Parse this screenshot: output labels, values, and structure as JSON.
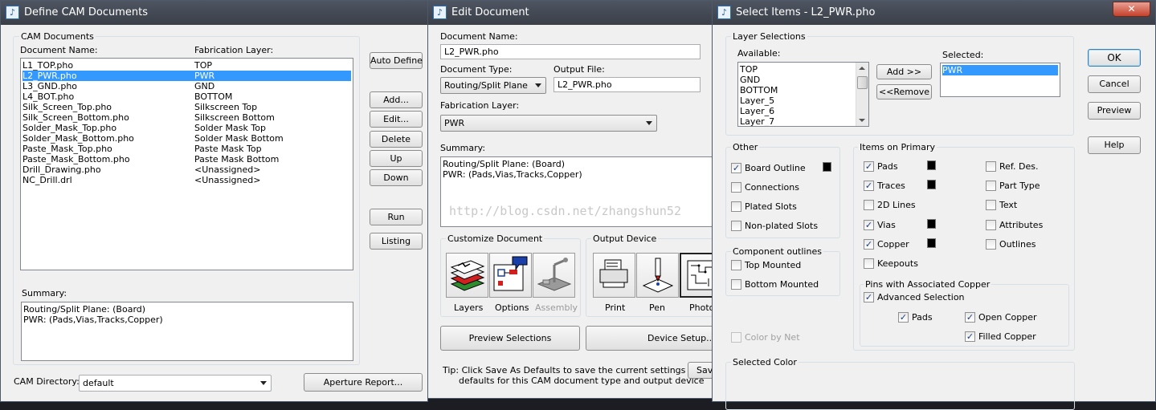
{
  "define_window": {
    "title": "Define CAM Documents",
    "group_label": "CAM Documents",
    "col_document_name": "Document Name:",
    "col_fabrication_layer": "Fabrication Layer:",
    "documents": [
      {
        "name": "L1_TOP.pho",
        "layer": "TOP"
      },
      {
        "name": "L2_PWR.pho",
        "layer": "PWR"
      },
      {
        "name": "L3_GND.pho",
        "layer": "GND"
      },
      {
        "name": "L4_BOT.pho",
        "layer": "BOTTOM"
      },
      {
        "name": "Silk_Screen_Top.pho",
        "layer": "Silkscreen Top"
      },
      {
        "name": "Silk_Screen_Bottom.pho",
        "layer": "Silkscreen Bottom"
      },
      {
        "name": "Solder_Mask_Top.pho",
        "layer": "Solder Mask Top"
      },
      {
        "name": "Solder_Mask_Bottom.pho",
        "layer": "Solder Mask Bottom"
      },
      {
        "name": "Paste_Mask_Top.pho",
        "layer": "Paste Mask Top"
      },
      {
        "name": "Paste_Mask_Bottom.pho",
        "layer": "Paste Mask Bottom"
      },
      {
        "name": "Drill_Drawing.pho",
        "layer": "<Unassigned>"
      },
      {
        "name": "NC_Drill.drl",
        "layer": "<Unassigned>"
      }
    ],
    "selected_index": 1,
    "buttons": {
      "auto_define": "Auto Define",
      "add": "Add...",
      "edit": "Edit...",
      "delete": "Delete",
      "up": "Up",
      "down": "Down",
      "run": "Run",
      "listing": "Listing",
      "aperture_report": "Aperture Report..."
    },
    "summary_label": "Summary:",
    "summary_line1": "Routing/Split Plane: (Board)",
    "summary_line2": "PWR: (Pads,Vias,Tracks,Copper)",
    "cam_directory_label": "CAM Directory:",
    "cam_directory_value": "default"
  },
  "edit_window": {
    "title": "Edit Document",
    "document_name_label": "Document Name:",
    "document_name_value": "L2_PWR.pho",
    "document_type_label": "Document Type:",
    "document_type_value": "Routing/Split Plane",
    "output_file_label": "Output File:",
    "output_file_value": "L2_PWR.pho",
    "fabrication_layer_label": "Fabrication Layer:",
    "fabrication_layer_value": "PWR",
    "summary_label": "Summary:",
    "summary_line1": "Routing/Split Plane: (Board)",
    "summary_line2": "PWR: (Pads,Vias,Tracks,Copper)",
    "watermark": "http://blog.csdn.net/zhangshun52",
    "customize_label": "Customize Document",
    "customize_items": [
      "Layers",
      "Options",
      "Assembly"
    ],
    "output_device_label": "Output Device",
    "output_items": [
      "Print",
      "Pen",
      "Photo"
    ],
    "preview_button": "Preview Selections",
    "device_setup_button": "Device Setup...",
    "save_button": "Save",
    "tip_line1": "Tip: Click Save As Defaults to save the current settings as the",
    "tip_line2": "defaults for this CAM document type and output device"
  },
  "select_window": {
    "title": "Select Items - L2_PWR.pho",
    "layer_selections_label": "Layer Selections",
    "available_label": "Available:",
    "available": [
      "TOP",
      "GND",
      "BOTTOM",
      "Layer_5",
      "Layer_6",
      "Layer_7"
    ],
    "selected_label": "Selected:",
    "selected": [
      "PWR"
    ],
    "add_button": "Add >>",
    "remove_button": "<<Remove",
    "ok_button": "OK",
    "cancel_button": "Cancel",
    "preview_button": "Preview",
    "help_button": "Help",
    "other_label": "Other",
    "other_items": [
      {
        "label": "Board Outline",
        "checked": true,
        "swatch": true
      },
      {
        "label": "Connections",
        "checked": false,
        "swatch": false
      },
      {
        "label": "Plated Slots",
        "checked": false,
        "swatch": false
      },
      {
        "label": "Non-plated Slots",
        "checked": false,
        "swatch": false
      }
    ],
    "component_outlines_label": "Component outlines",
    "component_items": [
      {
        "label": "Top Mounted",
        "checked": false
      },
      {
        "label": "Bottom Mounted",
        "checked": false
      }
    ],
    "color_by_net": "Color by Net",
    "items_on_primary_label": "Items on Primary",
    "primary_left": [
      {
        "label": "Pads",
        "checked": true,
        "swatch": true
      },
      {
        "label": "Traces",
        "checked": true,
        "swatch": true
      },
      {
        "label": "2D Lines",
        "checked": false,
        "swatch": false
      },
      {
        "label": "Vias",
        "checked": true,
        "swatch": true
      },
      {
        "label": "Copper",
        "checked": true,
        "swatch": true
      },
      {
        "label": "Keepouts",
        "checked": false,
        "swatch": false
      }
    ],
    "primary_right": [
      {
        "label": "Ref. Des.",
        "checked": false
      },
      {
        "label": "Part Type",
        "checked": false
      },
      {
        "label": "Text",
        "checked": false
      },
      {
        "label": "Attributes",
        "checked": false
      },
      {
        "label": "Outlines",
        "checked": false
      }
    ],
    "pins_label": "Pins with Associated Copper",
    "advanced_selection": "Advanced Selection",
    "pins_pads": "Pads",
    "open_copper": "Open Copper",
    "filled_copper": "Filled Copper",
    "selected_color_label": "Selected Color"
  },
  "close_glyph": "✕",
  "app_icon_glyph": "♪"
}
